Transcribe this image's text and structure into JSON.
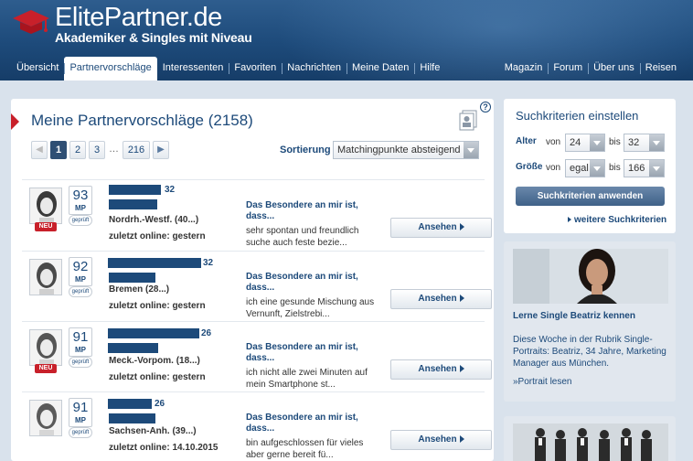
{
  "brand": {
    "title": "ElitePartner.de",
    "subtitle": "Akademiker & Singles mit Niveau"
  },
  "nav": {
    "items": [
      {
        "label": "Übersicht",
        "active": false
      },
      {
        "label": "Partnervorschläge",
        "active": true
      },
      {
        "label": "Interessenten",
        "active": false
      },
      {
        "label": "Favoriten",
        "active": false
      },
      {
        "label": "Nachrichten",
        "active": false
      },
      {
        "label": "Meine Daten",
        "active": false
      },
      {
        "label": "Hilfe",
        "active": false
      }
    ],
    "right": [
      {
        "label": "Magazin"
      },
      {
        "label": "Forum"
      },
      {
        "label": "Über uns"
      },
      {
        "label": "Reisen"
      }
    ]
  },
  "main": {
    "title": "Meine Partnervorschläge (2158)",
    "help": "?",
    "pager": {
      "prev": "◀",
      "pages": [
        "1",
        "2",
        "3"
      ],
      "current": "1",
      "dots": "…",
      "last": "216",
      "next": "▶"
    },
    "sort_label": "Sortierung",
    "sort_value": "Matchingpunkte absteigend",
    "button_label": "Ansehen",
    "about_heading": "Das Besondere an mir ist, dass...",
    "mp_unit": "MP",
    "verified": "geprüft",
    "new_badge": "NEU",
    "profiles": [
      {
        "score": "93",
        "age": "32",
        "new": true,
        "location": "Nordrh.-Westf. (40...)",
        "online": "zuletzt online: gestern",
        "about": "sehr spontan und freundlich suche auch feste bezie..."
      },
      {
        "score": "92",
        "age": "32",
        "new": false,
        "location": "Bremen (28...)",
        "online": "zuletzt online: gestern",
        "about": "ich eine gesunde Mischung aus Vernunft, Zielstrebi..."
      },
      {
        "score": "91",
        "age": "26",
        "new": true,
        "location": "Meck.-Vorpom. (18...)",
        "online": "zuletzt online: gestern",
        "about": "ich nicht alle zwei Minuten auf mein Smartphone st..."
      },
      {
        "score": "91",
        "age": "26",
        "new": false,
        "location": "Sachsen-Anh. (39...)",
        "online": "zuletzt online: 14.10.2015",
        "about": "bin aufgeschlossen für vieles aber gerne bereit fü..."
      }
    ]
  },
  "search": {
    "title": "Suchkriterien einstellen",
    "age": {
      "label": "Alter",
      "from_word": "von",
      "from": "24",
      "to_word": "bis",
      "to": "32"
    },
    "size": {
      "label": "Größe",
      "from_word": "von",
      "from": "egal",
      "to_word": "bis",
      "to": "166"
    },
    "apply_label": "Suchkriterien anwenden",
    "more_label": "weitere Suchkriterien"
  },
  "promo": {
    "title": "Lerne Single Beatriz kennen",
    "text": "Diese Woche in der Rubrik Single-Portraits: Beatriz, 34 Jahre, Marketing Manager aus München.",
    "link": "»Portrait lesen"
  },
  "colors": {
    "brand": "#1d4a7a",
    "accent": "#c8202a",
    "header": "#1d4a7a"
  }
}
